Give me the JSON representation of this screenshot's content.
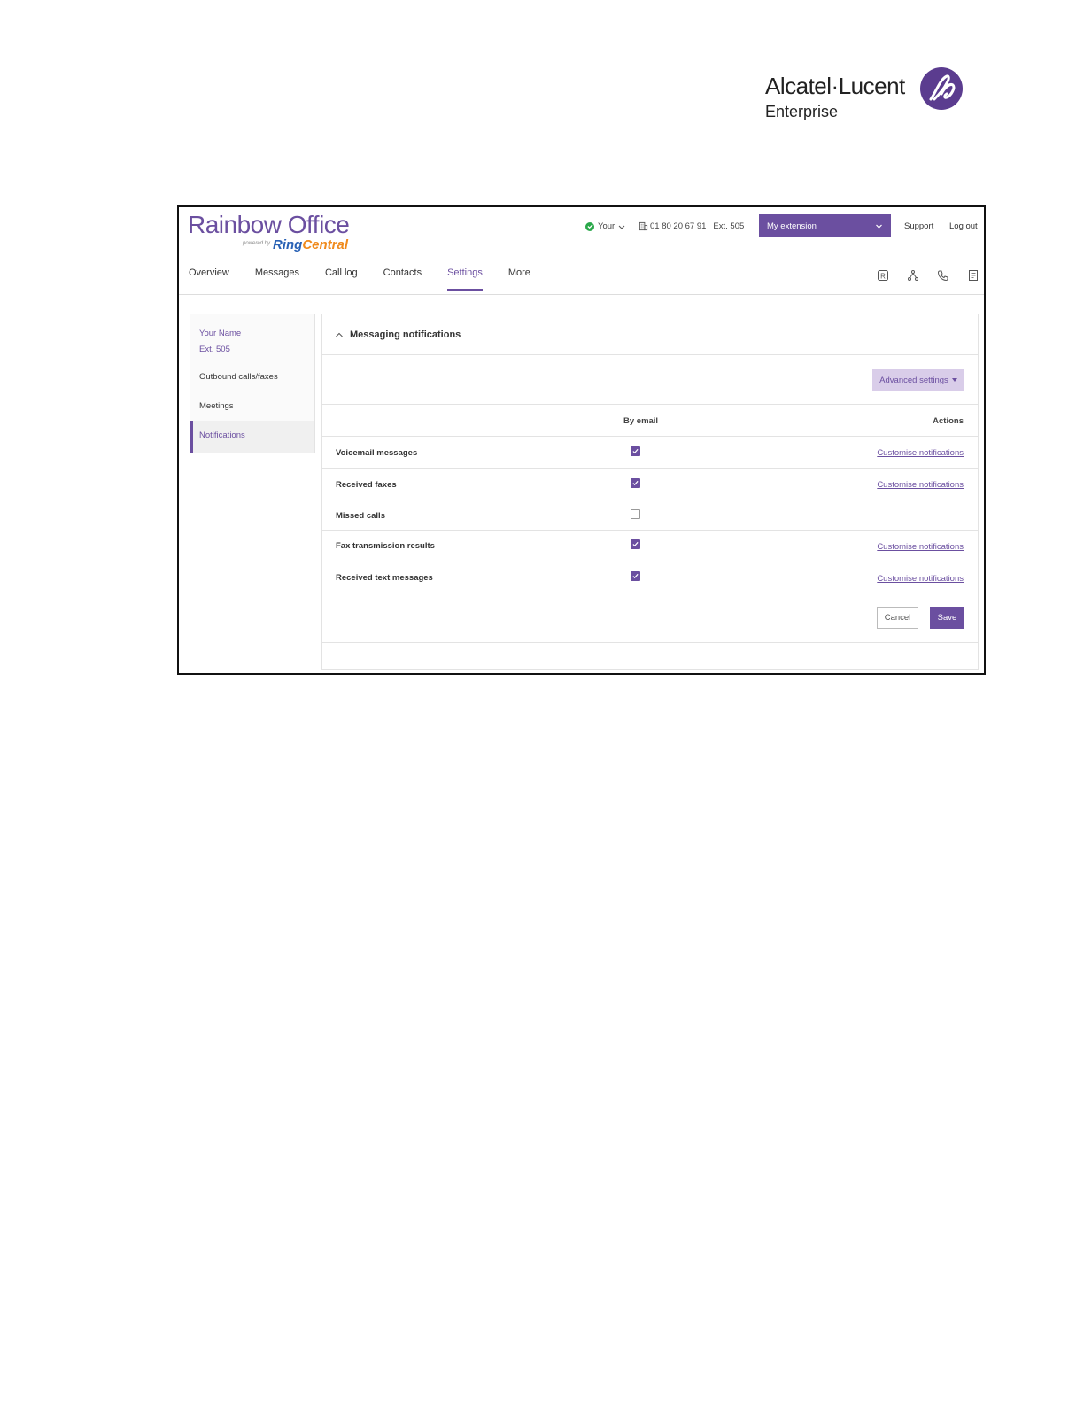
{
  "branding": {
    "name": "Alcatel·Lucent",
    "sub": "Enterprise",
    "logo_color": "#5b3c8f"
  },
  "app": {
    "title": "Rainbow Office",
    "powered_by": "powered by",
    "ring_part1": "Ring",
    "ring_part2": "Central",
    "accent": "#6b4fa0"
  },
  "header": {
    "status": "Your",
    "phone": "01 80 20 67 91",
    "ext": "Ext. 505",
    "extension_select": "My extension",
    "support": "Support",
    "logout": "Log out"
  },
  "nav": {
    "items": [
      {
        "label": "Overview"
      },
      {
        "label": "Messages"
      },
      {
        "label": "Call log"
      },
      {
        "label": "Contacts"
      },
      {
        "label": "Settings",
        "active": true
      },
      {
        "label": "More"
      }
    ],
    "icons": [
      "rainbow-icon",
      "network-icon",
      "phone-icon",
      "fax-icon"
    ]
  },
  "sidebar": {
    "user_name": "Your Name",
    "user_ext": "Ext. 505",
    "items": [
      {
        "label": "Outbound calls/faxes"
      },
      {
        "label": "Meetings"
      },
      {
        "label": "Notifications",
        "active": true
      }
    ]
  },
  "panel": {
    "title": "Messaging notifications",
    "advanced_settings": "Advanced settings",
    "col_email": "By email",
    "col_actions": "Actions",
    "rows": [
      {
        "label": "Voicemail messages",
        "checked": true,
        "action": "Customise notifications"
      },
      {
        "label": "Received faxes",
        "checked": true,
        "action": "Customise notifications"
      },
      {
        "label": "Missed calls",
        "checked": false,
        "action": ""
      },
      {
        "label": "Fax transmission results",
        "checked": true,
        "action": "Customise notifications"
      },
      {
        "label": "Received text messages",
        "checked": true,
        "action": "Customise notifications"
      }
    ],
    "cancel": "Cancel",
    "save": "Save"
  }
}
